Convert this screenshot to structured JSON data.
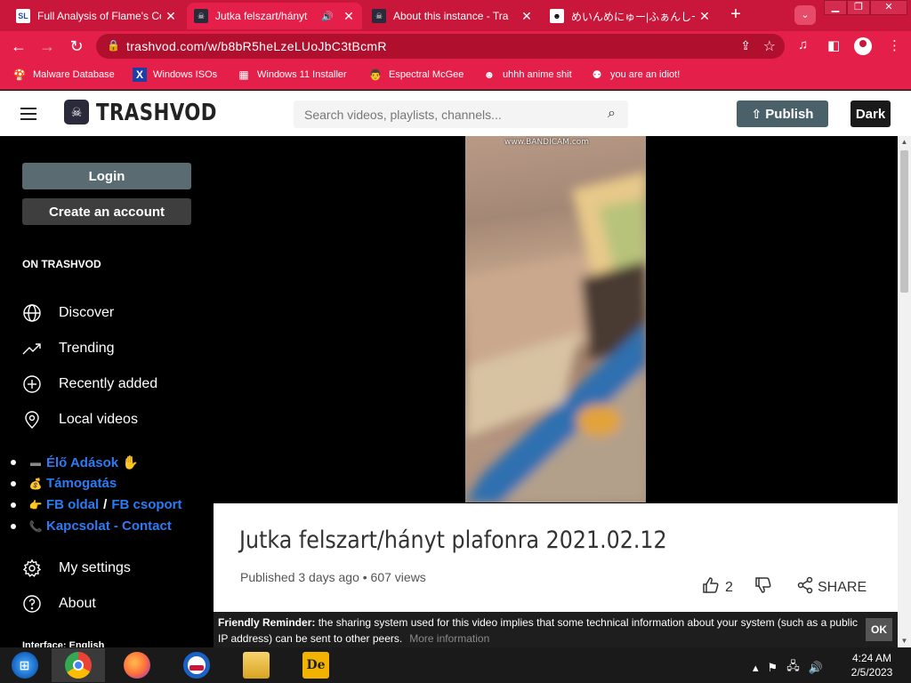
{
  "browser": {
    "tabs": [
      {
        "favicon": "SL",
        "title": "Full Analysis of Flame's Co",
        "close": "✕"
      },
      {
        "favicon": "☠",
        "title": "Jutka felszart/hányt",
        "audio": "🔊",
        "close": "✕"
      },
      {
        "favicon": "☠",
        "title": "About this instance - Tra",
        "close": "✕"
      },
      {
        "favicon": "☻",
        "title": "めいんめにゅー|ふぁんし一あい",
        "close": "✕"
      }
    ],
    "new_tab": "+",
    "tab_search": "⌄",
    "window_controls": {
      "minimize": "▁",
      "restore": "❐",
      "close": "✕"
    },
    "address_url": "trashvod.com/w/b8bR5heLzeLUoJbC3tBcmR",
    "bookmarks": [
      {
        "icon": "🍄",
        "label": "Malware Database"
      },
      {
        "icon": "X",
        "label": "Windows ISOs"
      },
      {
        "icon": "▦",
        "label": "Windows 11 Installer"
      },
      {
        "icon": "👨",
        "label": "Espectral McGee"
      },
      {
        "icon": "☻",
        "label": "uhhh anime shit"
      },
      {
        "icon": "⚉",
        "label": "you are an idiot!"
      }
    ]
  },
  "site": {
    "logo_text": "TRASHVOD",
    "search_placeholder": "Search videos, playlists, channels...",
    "publish_label": "Publish",
    "dark_label": "Dark"
  },
  "sidebar": {
    "login_label": "Login",
    "create_label": "Create an account",
    "section_label": "ON TRASHVOD",
    "nav": [
      {
        "icon": "globe-icon",
        "label": "Discover"
      },
      {
        "icon": "trending-icon",
        "label": "Trending"
      },
      {
        "icon": "plus-circle-icon",
        "label": "Recently added"
      },
      {
        "icon": "location-icon",
        "label": "Local videos"
      }
    ],
    "links": [
      {
        "icon": "▬",
        "label": "Élő Adások",
        "suffix": "✋"
      },
      {
        "icon": "💰",
        "label": "Támogatás"
      },
      {
        "icon": "👉",
        "label": "FB oldal",
        "sep": "/",
        "label2": "FB csoport"
      },
      {
        "icon": "📞",
        "label": "Kapcsolat - Contact"
      }
    ],
    "settings_label": "My settings",
    "about_label": "About",
    "interface_label": "Interface: English"
  },
  "video": {
    "watermark": "www.BANDICAM.com",
    "title": "Jutka felszart/hányt plafonra 2021.02.12",
    "meta": "Published 3 days ago • 607 views",
    "likes": "2",
    "share_label": "SHARE"
  },
  "reminder": {
    "lead": "Friendly Reminder:",
    "text": " the sharing system used for this video implies that some technical information about your system (such as a public IP address) can be sent to other peers.",
    "more": "More information",
    "ok": "OK"
  },
  "taskbar": {
    "time": "4:24 AM",
    "date": "2/5/2023"
  }
}
